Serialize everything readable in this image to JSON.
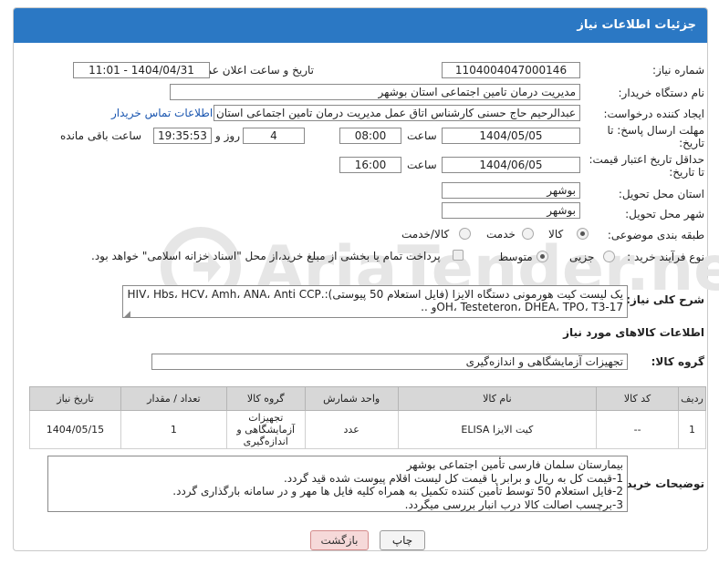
{
  "header": {
    "title": "جزئیات اطلاعات نیاز"
  },
  "need_number": {
    "label": "شماره نیاز:",
    "value": "1104004047000146"
  },
  "announce_datetime": {
    "label": "تاریخ و ساعت اعلان عمومی:",
    "value": "1404/04/31 - 11:01"
  },
  "buyer_org": {
    "label": "نام دستگاه خریدار:",
    "value": "مدیریت درمان تامین اجتماعی استان بوشهر"
  },
  "requester": {
    "label": "ایجاد کننده درخواست:",
    "value": "عبدالرحیم حاج حسنی کارشناس اتاق عمل مدیریت درمان تامین اجتماعی استان",
    "contact_link": "اطلاعات تماس خریدار"
  },
  "reply_deadline": {
    "label_line1": "مهلت ارسال پاسخ: تا",
    "label_line2": "تاریخ:",
    "date": "1404/05/05",
    "time_label": "ساعت",
    "time": "08:00",
    "days": "4",
    "days_label": "روز و",
    "remaining": "19:35:53",
    "remaining_label": "ساعت باقی مانده"
  },
  "price_validity": {
    "label_line1": "حداقل تاریخ اعتبار قیمت:",
    "label_line2": "تا تاریخ:",
    "date": "1404/06/05",
    "time_label": "ساعت",
    "time": "16:00"
  },
  "delivery_province": {
    "label": "استان محل تحویل:",
    "value": "بوشهر"
  },
  "delivery_city": {
    "label": "شهر محل تحویل:",
    "value": "بوشهر"
  },
  "category": {
    "label": "طبقه بندی موضوعی:",
    "options": [
      "کالا",
      "خدمت",
      "کالا/خدمت"
    ],
    "selected": "کالا"
  },
  "purchase_type": {
    "label": "نوع فرآیند خرید :",
    "options": [
      "جزیی",
      "متوسط"
    ],
    "selected": "متوسط",
    "treasury_note": "پرداخت تمام یا بخشی از مبلغ خرید،از محل \"اسناد خزانه اسلامی\" خواهد بود."
  },
  "description": {
    "label": "شرح کلی نیاز:",
    "line1": "یک لیست کیت هورمونی دستگاه الایزا (فایل استعلام 50 پیوستی):.HIV، Hbs، HCV، Amh، ANA، Anti CCP",
    "line2": "17-OH، Testeteron، DHEA، TPO، T3و .."
  },
  "goods_section": {
    "title": "اطلاعات کالاهای مورد نیاز",
    "group_label": "گروه کالا:",
    "group_value": "تجهیزات آزمایشگاهی و اندازه‌گیری"
  },
  "table": {
    "headers": [
      "ردیف",
      "کد کالا",
      "نام کالا",
      "واحد شمارش",
      "گروه کالا",
      "تعداد / مقدار",
      "تاریخ نیاز"
    ],
    "rows": [
      [
        "1",
        "--",
        "کیت الایزا ELISA",
        "عدد",
        "تجهیزات آزمایشگاهی و اندازه‌گیری",
        "1",
        "1404/05/15"
      ]
    ]
  },
  "buyer_notes": {
    "label": "توضیحات خریدار:",
    "lines": [
      "بیمارستان سلمان فارسی تأمین اجتماعی بوشهر",
      "1-قیمت کل به ریال و برابر با قیمت کل لیست اقلام پیوست شده قید گردد.",
      "2-فایل استعلام 50 توسط تأمین کننده تکمیل به همراه کلیه فایل ها مهر و در سامانه بارگذاری گردد.",
      "3-برچسب اصالت کالا درب انبار بررسی میگردد."
    ]
  },
  "buttons": {
    "print": "چاپ",
    "back": "بازگشت"
  },
  "watermark_text": "AriaTender.neT",
  "colors": {
    "header_bg": "#2b78c4",
    "back_button_bg": "#f6d9d9",
    "link": "#1a56b0",
    "watermark": "#e3e3e3"
  }
}
